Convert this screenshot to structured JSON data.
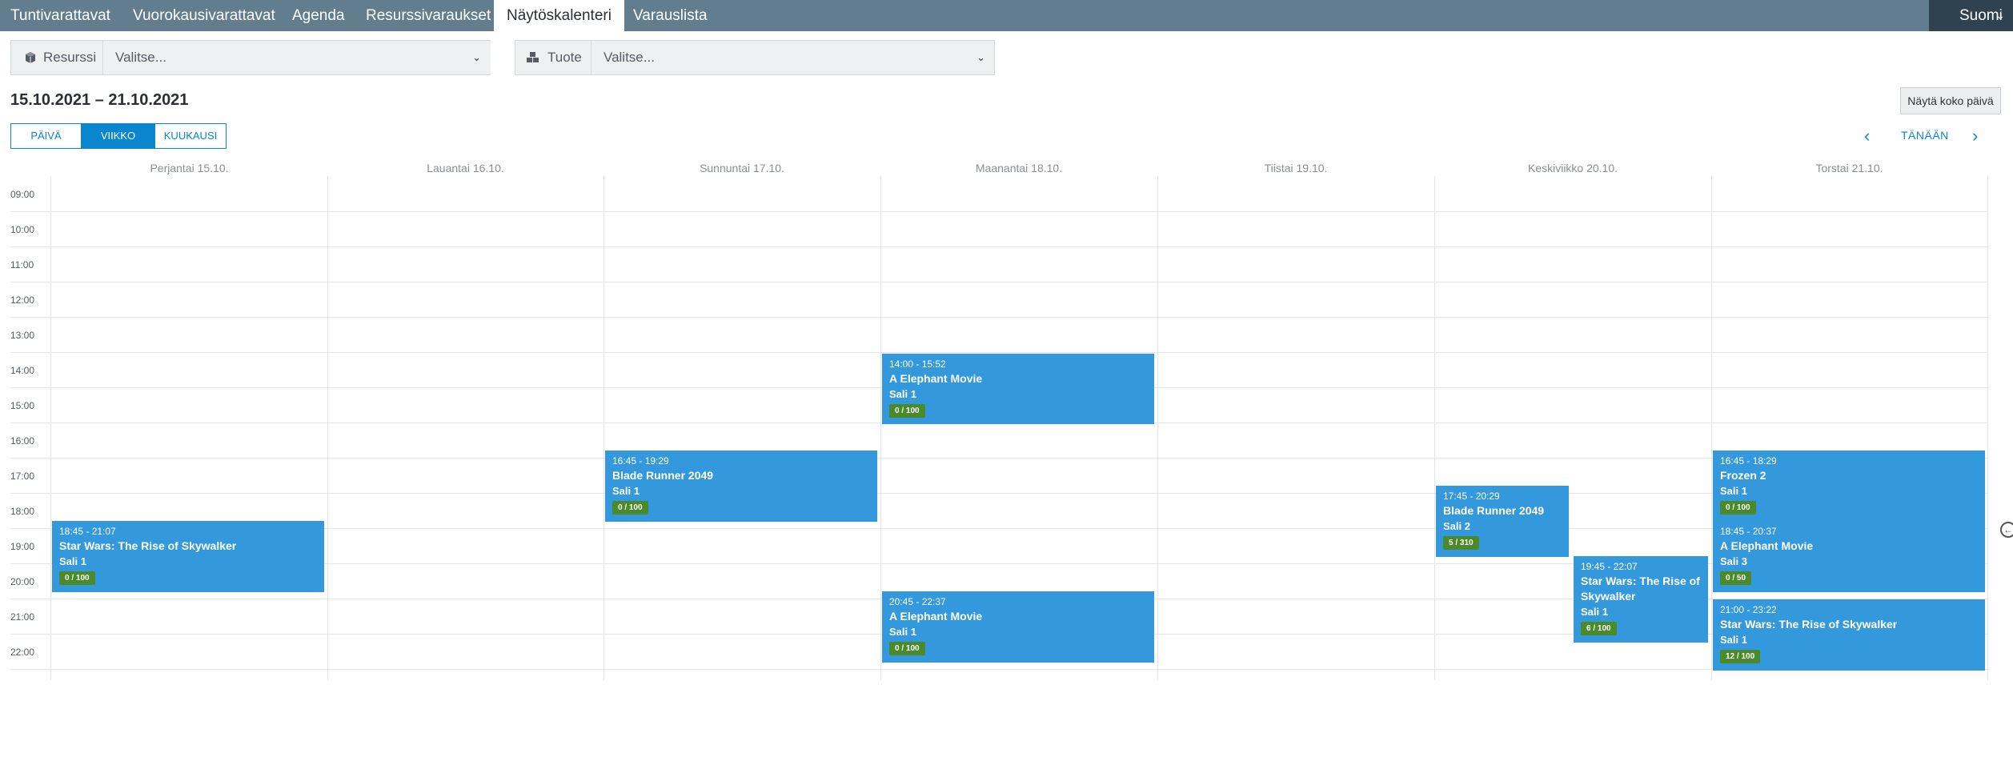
{
  "nav": {
    "tabs": [
      {
        "label": "Tuntivarattavat"
      },
      {
        "label": "Vuorokausivarattavat"
      },
      {
        "label": "Agenda"
      },
      {
        "label": "Resurssivaraukset"
      },
      {
        "label": "Näytöskalenteri"
      },
      {
        "label": "Varauslista"
      }
    ],
    "language": "Suomi"
  },
  "filters": {
    "resource": {
      "label": "Resurssi",
      "placeholder": "Valitse..."
    },
    "product": {
      "label": "Tuote",
      "placeholder": "Valitse..."
    }
  },
  "range_title": "15.10.2021 – 21.10.2021",
  "views": {
    "day": "PÄIVÄ",
    "week": "VIIKKO",
    "month": "KUUKAUSI",
    "active": "week"
  },
  "full_day_button": "Näytä koko päivä",
  "today_button": "TÄNÄÄN",
  "days": [
    "Perjantai 15.10.",
    "Lauantai 16.10.",
    "Sunnuntai 17.10.",
    "Maanantai 18.10.",
    "Tiistai 19.10.",
    "Keskiviikko 20.10.",
    "Torstai 21.10."
  ],
  "hours": [
    "09:00",
    "10:00",
    "11:00",
    "12:00",
    "13:00",
    "14:00",
    "15:00",
    "16:00",
    "17:00",
    "18:00",
    "19:00",
    "20:00",
    "21:00",
    "22:00"
  ],
  "events": [
    {
      "time": "18:45 - 21:07",
      "title": "Star Wars: The Rise of Skywalker",
      "room": "Sali 1",
      "count": "0 / 100"
    },
    {
      "time": "16:45 - 19:29",
      "title": "Blade Runner 2049",
      "room": "Sali 1",
      "count": "0 / 100"
    },
    {
      "time": "14:00 - 15:52",
      "title": "A Elephant Movie",
      "room": "Sali 1",
      "count": "0 / 100"
    },
    {
      "time": "20:45 - 22:37",
      "title": "A Elephant Movie",
      "room": "Sali 1",
      "count": "0 / 100"
    },
    {
      "time": "17:45 - 20:29",
      "title": "Blade Runner 2049",
      "room": "Sali 2",
      "count": "5 / 310"
    },
    {
      "time": "19:45 - 22:07",
      "title": "Star Wars: The Rise of Skywalker",
      "room": "Sali 1",
      "count": "6 / 100"
    },
    {
      "time": "16:45 - 18:29",
      "title": "Frozen 2",
      "room": "Sali 1",
      "count": "0 / 100"
    },
    {
      "time": "18:45 - 20:37",
      "title": "A Elephant Movie",
      "room": "Sali 3",
      "count": "0 / 50"
    },
    {
      "time": "21:00 - 23:22",
      "title": "Star Wars: The Rise of Skywalker",
      "room": "Sali 1",
      "count": "12 / 100"
    }
  ],
  "colors": {
    "nav_bg": "#627d8e",
    "accent": "#0a86cf",
    "event_bg": "#3499dc",
    "badge_bg": "#4b8a2a"
  }
}
